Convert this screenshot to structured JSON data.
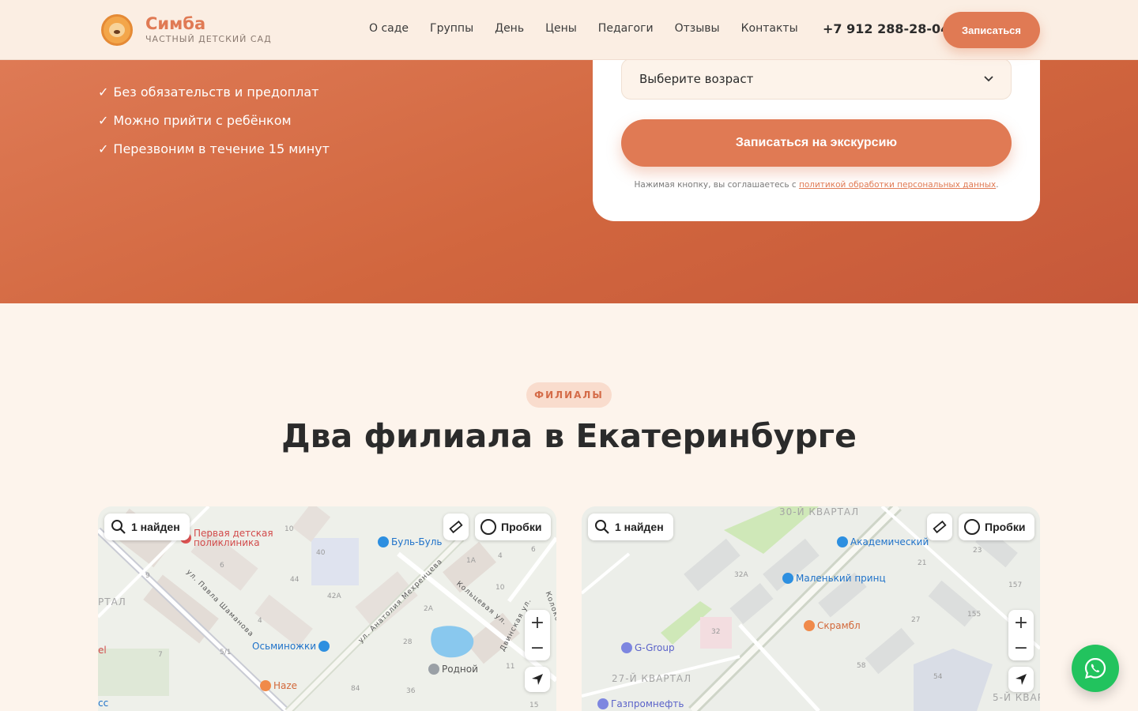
{
  "header": {
    "brand_name": "Симба",
    "brand_sub": "ЧАСТНЫЙ ДЕТСКИЙ САД",
    "nav": [
      "О саде",
      "Группы",
      "День",
      "Цены",
      "Педагоги",
      "Отзывы",
      "Контакты"
    ],
    "phone": "+7 912 288-28-04",
    "cta_label": "Записаться"
  },
  "hero": {
    "benefits": [
      "Без обязательств и предоплат",
      "Можно прийти с ребёнком",
      "Перезвоним в течение 15 минут"
    ],
    "check_mark": "✓",
    "form": {
      "age_select_value": "Выберите возраст",
      "submit_label": "Записаться на экскурсию",
      "consent_text": "Нажимая кнопку, вы соглашаетесь с ",
      "consent_link": "политикой обработки персональных данных",
      "consent_end": "."
    }
  },
  "branches": {
    "eyebrow": "ФИЛИАЛЫ",
    "title": "Два филиала в Екатеринбурге"
  },
  "maps": {
    "search_result": "1 найден",
    "traffic_label": "Пробки",
    "zoom_in": "+",
    "zoom_out": "−",
    "left": {
      "pois": [
        "Первая детская",
        "поликлиника",
        "Буль-Буль",
        "Осьминожки",
        "Haze",
        "Родной"
      ],
      "streets": [
        "ул. Павла Шаманова",
        "ул. Анатолия Мехренцева",
        "Кольцевая ул.",
        "Двинская ул.",
        "Колоко"
      ],
      "district": "РТАЛ",
      "edge": [
        "el",
        "сс"
      ],
      "numbers": [
        "10",
        "40",
        "6",
        "44",
        "42А",
        "4",
        "9",
        "7",
        "5/1",
        "1А",
        "4",
        "10",
        "2А",
        "28",
        "11",
        "84",
        "36",
        "6",
        "15"
      ]
    },
    "right": {
      "pois": [
        "Академический",
        "Маленький принц",
        "Скрамбл",
        "G-Group",
        "Газпромнефть"
      ],
      "districts": [
        "30-Й КВАРТАЛ",
        "27-Й КВАРТАЛ",
        "5-Й КВАР"
      ],
      "numbers": [
        "23",
        "21",
        "157",
        "32А",
        "155",
        "27",
        "32",
        "58",
        "54"
      ]
    }
  },
  "colors": {
    "accent": "#e07a54",
    "hero_bg": "#d1663e",
    "page_bg": "#fdf4ec",
    "whatsapp": "#22c35e"
  },
  "icons": {
    "search": "search-icon",
    "ruler": "ruler-icon",
    "traffic": "traffic-icon",
    "locate": "locate-arrow-icon",
    "whatsapp": "whatsapp-icon"
  }
}
